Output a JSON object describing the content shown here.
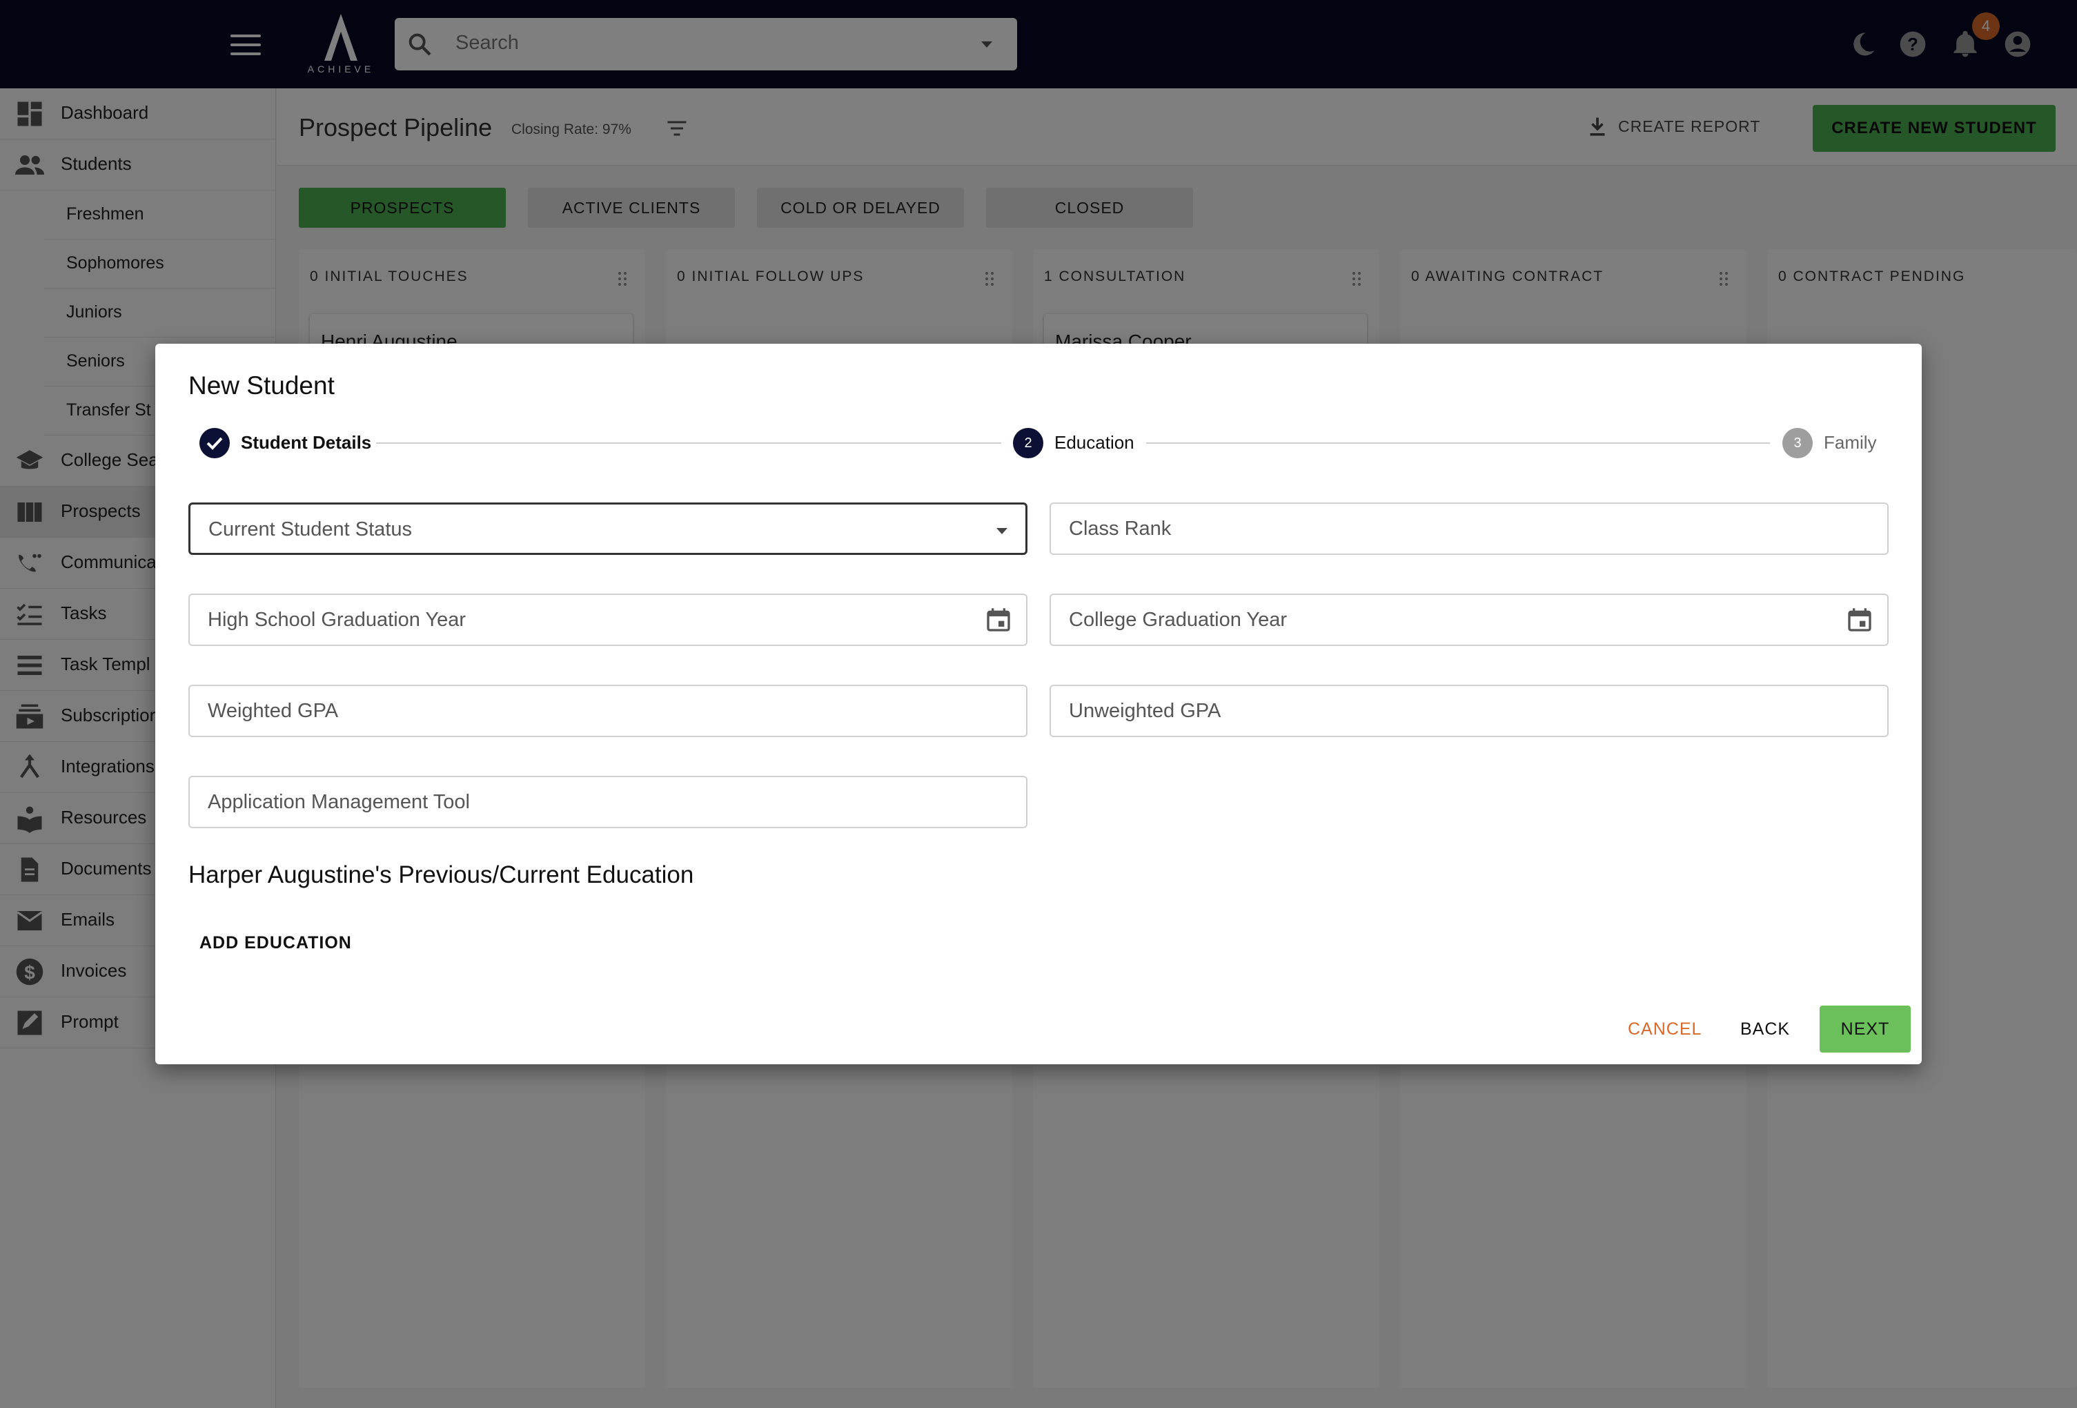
{
  "topbar": {
    "logo_text": "ACHIEVE",
    "search_placeholder": "Search",
    "notification_count": "4"
  },
  "sidebar": {
    "items": [
      {
        "label": "Dashboard",
        "icon": "dashboard-icon"
      },
      {
        "label": "Students",
        "icon": "people-icon"
      },
      {
        "label": "College Sea",
        "icon": "school-icon"
      },
      {
        "label": "Prospects",
        "icon": "columns-icon"
      },
      {
        "label": "Communica",
        "icon": "communication-icon"
      },
      {
        "label": "Tasks",
        "icon": "checklist-icon"
      },
      {
        "label": "Task Templ",
        "icon": "list-icon"
      },
      {
        "label": "Subscriptior",
        "icon": "subscriptions-icon"
      },
      {
        "label": "Integrations",
        "icon": "merge-icon"
      },
      {
        "label": "Resources",
        "icon": "book-icon"
      },
      {
        "label": "Documents",
        "icon": "document-icon"
      },
      {
        "label": "Emails",
        "icon": "mail-icon"
      },
      {
        "label": "Invoices",
        "icon": "dollar-icon"
      },
      {
        "label": "Prompt",
        "icon": "edit-icon"
      }
    ],
    "student_subitems": [
      "Freshmen",
      "Sophomores",
      "Juniors",
      "Seniors",
      "Transfer St"
    ]
  },
  "header": {
    "title": "Prospect Pipeline",
    "closing_rate": "Closing Rate: 97%",
    "create_report": "CREATE REPORT",
    "create_student": "CREATE NEW STUDENT"
  },
  "tabs": [
    "PROSPECTS",
    "ACTIVE CLIENTS",
    "COLD OR DELAYED",
    "CLOSED"
  ],
  "columns": [
    {
      "title": "0 INITIAL TOUCHES",
      "card": "Henri Augustine"
    },
    {
      "title": "0 INITIAL FOLLOW UPS",
      "card": ""
    },
    {
      "title": "1 CONSULTATION",
      "card": "Marissa Cooper"
    },
    {
      "title": "0 AWAITING CONTRACT",
      "card": ""
    },
    {
      "title": "0 CONTRACT PENDING",
      "card": ""
    }
  ],
  "modal": {
    "title": "New Student",
    "steps": [
      {
        "number": "1",
        "label": "Student Details",
        "state": "done"
      },
      {
        "number": "2",
        "label": "Education",
        "state": "active"
      },
      {
        "number": "3",
        "label": "Family",
        "state": "pending"
      }
    ],
    "fields": {
      "current_status": "Current Student Status",
      "class_rank": "Class Rank",
      "hs_grad_year": "High School Graduation Year",
      "college_grad_year": "College Graduation Year",
      "weighted_gpa": "Weighted GPA",
      "unweighted_gpa": "Unweighted GPA",
      "app_tool": "Application Management Tool"
    },
    "section_heading": "Harper Augustine's Previous/Current Education",
    "add_education": "ADD EDUCATION",
    "cancel": "CANCEL",
    "back": "BACK",
    "next": "NEXT"
  },
  "colors": {
    "topbar": "#050823",
    "accent_green": "#4caf50",
    "cancel_orange": "#d9692b",
    "step_dark": "#0d1035"
  }
}
